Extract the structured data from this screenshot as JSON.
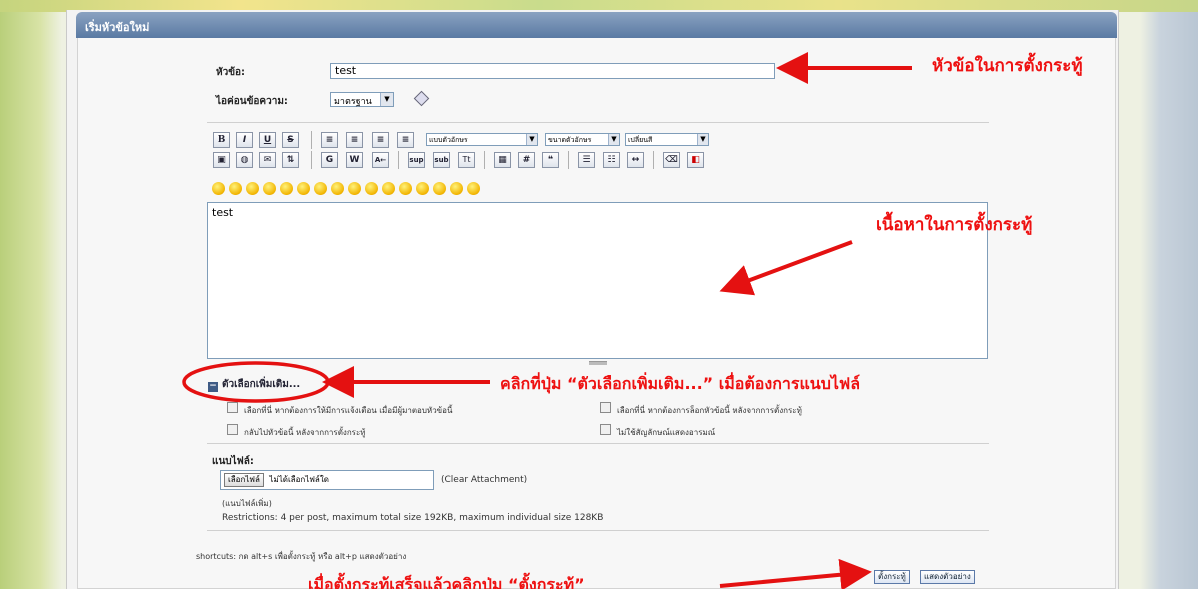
{
  "form": {
    "title": "เริ่มหัวข้อใหม่",
    "subject_label": "หัวข้อ:",
    "subject_value": "test",
    "icon_label": "ไอค่อนข้อความ:",
    "icon_select": "มาตรฐาน"
  },
  "toolbar": {
    "font_select": "แบบตัวอักษร",
    "size_select": "ขนาดตัวอักษร",
    "color_select": "เปลี่ยนสี",
    "row1_icons": [
      "bold-icon",
      "italic-icon",
      "underline-icon",
      "strikethrough-icon",
      "align-left-icon",
      "align-center-icon",
      "align-right-icon",
      "justify-icon"
    ],
    "row2_icons": [
      "image-icon",
      "link-icon",
      "email-icon",
      "ftp-icon",
      "google-icon",
      "wikipedia-icon",
      "rtl-icon",
      "superscript-icon",
      "subscript-icon",
      "teletype-icon",
      "table-icon",
      "code-icon",
      "quote-icon",
      "bullet-list-icon",
      "numbered-list-icon",
      "horizontal-rule-icon",
      "remove-format-icon",
      "toggle-view-icon"
    ],
    "bold": "B",
    "italic": "I",
    "underline": "U",
    "strike": "S",
    "sup": "sup",
    "sub": "sub",
    "tt": "Tt",
    "google": "G",
    "wiki": "W",
    "rtl": "A←",
    "hash": "#"
  },
  "editor": {
    "content": "test"
  },
  "options": {
    "toggle_label": "ตัวเลือกเพิ่มเติม...",
    "opt1": "เลือกที่นี่ หากต้องการให้มีการแจ้งเตือน เมื่อมีผู้มาตอบหัวข้อนี้",
    "opt2": "เลือกที่นี่ หากต้องการล็อกหัวข้อนี้ หลังจากการตั้งกระทู้",
    "opt3": "กลับไปหัวข้อนี้ หลังจากการตั้งกระทู้",
    "opt4": "ไม่ใช้สัญลักษณ์แสดงอารมณ์"
  },
  "attachments": {
    "label": "แนบไฟล์:",
    "choose_button": "เลือกไฟล์",
    "no_file": "ไม่ได้เลือกไฟล์ใด",
    "clear": "(Clear Attachment)",
    "more": "(แนบไฟล์เพิ่ม)",
    "restrictions": "Restrictions: 4 per post, maximum total size 192KB, maximum individual size 128KB"
  },
  "footer": {
    "shortcuts": "shortcuts: กด alt+s เพื่อตั้งกระทู้ หรือ alt+p แสดงตัวอย่าง",
    "post_button": "ตั้งกระทู้",
    "preview_button": "แสดงตัวอย่าง"
  },
  "annotations": {
    "subject_note": "หัวข้อในการตั้งกระทู้",
    "content_note": "เนื้อหาในการตั้งกระทู้",
    "options_note": "คลิกที่ปุ่ม “ตัวเลือกเพิ่มเติม...” เมื่อต้องการแนบไฟล์",
    "post_note": "เมื่อตั้งกระทู้เสร็จแล้วคลิกปุ่ม “ตั้งกระทู้”",
    "color": "#e41111"
  }
}
